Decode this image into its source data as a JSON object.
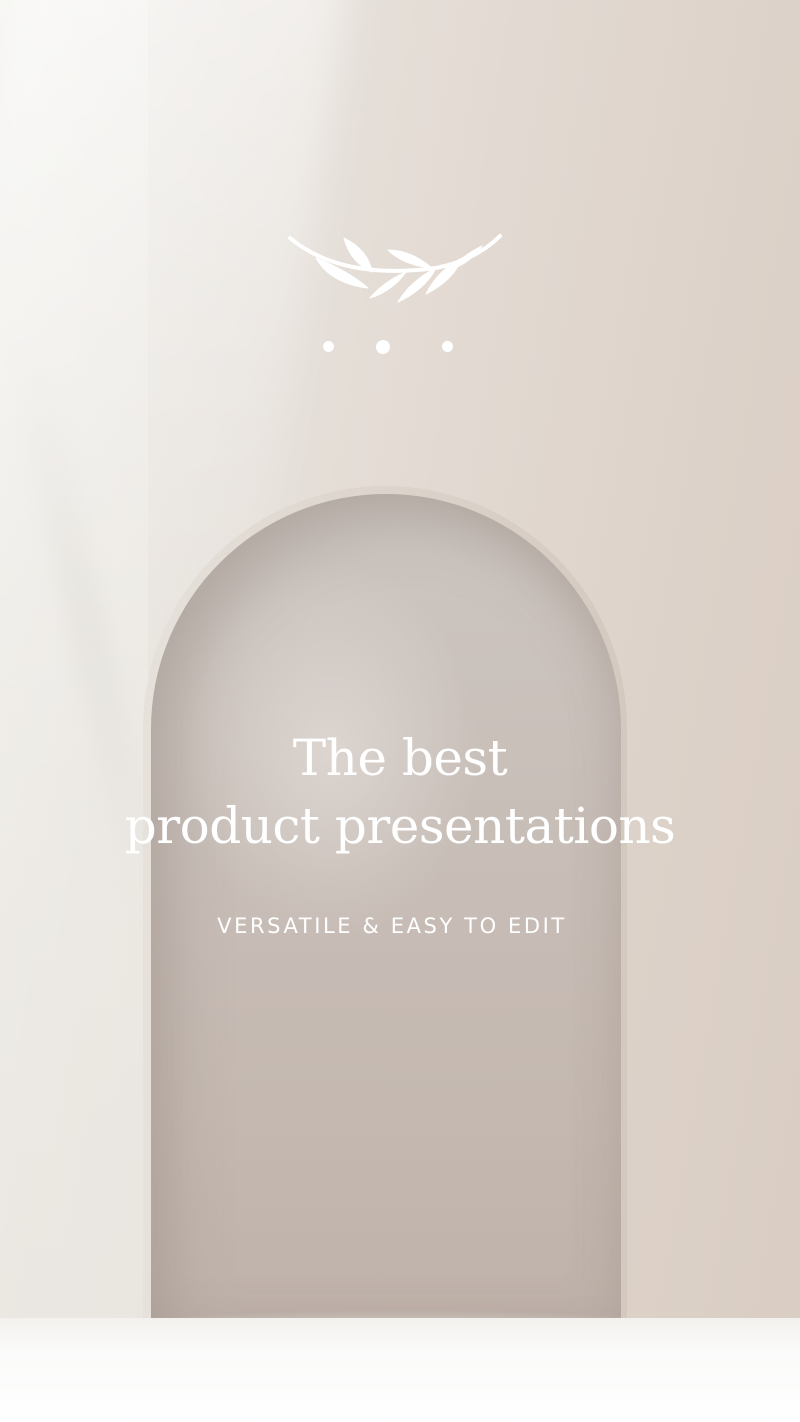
{
  "headline": {
    "line1": "The best",
    "line2": "product presentations"
  },
  "subtitle": "VERSATILE & EASY TO EDIT",
  "decor": {
    "leaf_icon": "olive-branch-icon",
    "dots_icon": "three-dots-icon",
    "dot_count": 3
  },
  "colors": {
    "text": "#ffffff",
    "wall": "#ddd2c9",
    "arch": "#c8beb8",
    "floor": "#ffffff"
  }
}
